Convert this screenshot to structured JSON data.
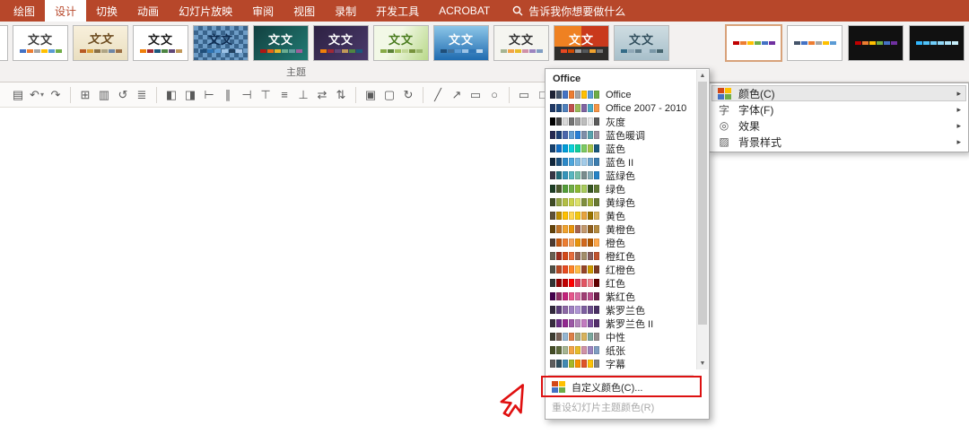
{
  "tabbar": {
    "bg": "#B7472A",
    "tabs": [
      {
        "label": "绘图",
        "selected": false
      },
      {
        "label": "设计",
        "selected": true
      },
      {
        "label": "切换",
        "selected": false
      },
      {
        "label": "动画",
        "selected": false
      },
      {
        "label": "幻灯片放映",
        "selected": false
      },
      {
        "label": "审阅",
        "selected": false
      },
      {
        "label": "视图",
        "selected": false
      },
      {
        "label": "录制",
        "selected": false
      },
      {
        "label": "开发工具",
        "selected": false
      },
      {
        "label": "ACROBAT",
        "selected": false
      }
    ],
    "tellme_label": "告诉我你想要做什么"
  },
  "themes": {
    "group_label": "主题",
    "items": [
      {
        "partial": true,
        "label": "",
        "bg": "#ffffff"
      },
      {
        "label": "文文",
        "bg": "#ffffff",
        "fg": "#404040",
        "strip": [
          "#4472C4",
          "#ED7D31",
          "#A5A5A5",
          "#FFC000",
          "#5B9BD5",
          "#70AD47"
        ]
      },
      {
        "label": "文文",
        "bg": "linear-gradient(180deg,#f8f0dc,#eadfc0)",
        "fg": "#6b4a1e",
        "script": true,
        "strip": [
          "#B85A23",
          "#D99E36",
          "#8A6F45",
          "#B0A584",
          "#6F87A6",
          "#9C6F44"
        ]
      },
      {
        "label": "文文",
        "bg": "#ffffff",
        "fg": "#1a1a1a",
        "serif": true,
        "strip": [
          "#F07F09",
          "#9F2936",
          "#1B587C",
          "#4E8542",
          "#604878",
          "#C19859"
        ]
      },
      {
        "label": "文文",
        "bg": "conic-gradient(#39648c 25%, #6d9cc6 0 50%, #39648c 0 75%, #6d9cc6 0) 0 0 / 10px 10px",
        "fg": "#0f2d52",
        "strip": [
          "#1F4E79",
          "#2E75B6",
          "#5B9BD5",
          "#9DC3E6",
          "#21405F",
          "#A7C6E8"
        ]
      },
      {
        "label": "文文",
        "bg": "linear-gradient(135deg,#123f3f,#217c74)",
        "fg": "#ffffff",
        "strip": [
          "#B01513",
          "#EA6312",
          "#E6B729",
          "#6AAC90",
          "#5F9C9D",
          "#9E5E9B"
        ]
      },
      {
        "label": "文文",
        "bg": "linear-gradient(135deg,#2d2142,#4a3a6b)",
        "fg": "#ffffff",
        "strip": [
          "#F07F09",
          "#9F2936",
          "#604878",
          "#C19859",
          "#4E8542",
          "#1B587C"
        ]
      },
      {
        "label": "文文",
        "bg": "linear-gradient(120deg,#f2f8e6 40%,#b9d98a)",
        "fg": "#4a7c1f",
        "strip": [
          "#87AB47",
          "#5B8236",
          "#A2C05E",
          "#C2D796",
          "#77933C",
          "#9CB86E"
        ]
      },
      {
        "label": "文文",
        "bg": "linear-gradient(180deg,#8cc6e8,#1f6bb0)",
        "fg": "#ffffff",
        "strip": [
          "#1F4E79",
          "#41719C",
          "#5B9BD5",
          "#9DC3E6",
          "#2E75B6",
          "#BDD7EE"
        ]
      },
      {
        "label": "文文",
        "bg": "#f5f5f0",
        "fg": "#333333",
        "strip": [
          "#A5B592",
          "#F3A447",
          "#E7BC29",
          "#D092A7",
          "#9C85C0",
          "#809EC2"
        ]
      },
      {
        "label": "文文",
        "bg": "linear-gradient(180deg, rgba(0,0,0,0) 60%, #2f2d2b 60%), linear-gradient(90deg,#ef8122 50%,#c9391c 50%)",
        "fg": "#ffffff",
        "strip": [
          "#E64823",
          "#D04A02",
          "#9C9C9C",
          "#54585B",
          "#F0A22E",
          "#777777"
        ]
      },
      {
        "label": "文文",
        "bg": "linear-gradient(180deg,#cfdde2,#a7bfca)",
        "fg": "#33505e",
        "strip": [
          "#336B87",
          "#90A8B7",
          "#5F7C8A",
          "#B4C9D4",
          "#7A98A8",
          "#46656F"
        ]
      }
    ]
  },
  "variants": {
    "items": [
      {
        "bg": "#ffffff",
        "selected": true,
        "strip": [
          "#C00000",
          "#ED7D31",
          "#FFC000",
          "#70AD47",
          "#4472C4",
          "#7030A0"
        ]
      },
      {
        "bg": "#ffffff",
        "selected": false,
        "strip": [
          "#44546A",
          "#4472C4",
          "#ED7D31",
          "#A5A5A5",
          "#FFC000",
          "#5B9BD5"
        ]
      },
      {
        "bg": "#111111",
        "selected": false,
        "strip": [
          "#C00000",
          "#ED7D31",
          "#FFC000",
          "#70AD47",
          "#4472C4",
          "#7030A0"
        ]
      },
      {
        "bg": "#111111",
        "selected": false,
        "strip": [
          "#31B6FD",
          "#51C3F9",
          "#70CDF9",
          "#8FD8F8",
          "#AEE3F8",
          "#C5ECF9"
        ]
      }
    ]
  },
  "variants_menu": {
    "items": [
      {
        "key": "colors",
        "label": "颜色(C)",
        "highlighted": true,
        "icon_glyph": ""
      },
      {
        "key": "fonts",
        "label": "字体(F)",
        "highlighted": false,
        "icon_glyph": "字"
      },
      {
        "key": "effects",
        "label": "效果",
        "highlighted": false,
        "icon_glyph": "◎"
      },
      {
        "key": "background-styles",
        "label": "背景样式",
        "highlighted": false,
        "icon_glyph": "▨"
      }
    ],
    "chevron_glyph": "▸",
    "palette_icon_colors": [
      "#D34817",
      "#FFC000",
      "#4472C4",
      "#70AD47"
    ]
  },
  "colors_menu": {
    "header": "Office",
    "schemes": [
      {
        "name": "Office",
        "colors": [
          "#1F2437",
          "#44546A",
          "#4472C4",
          "#ED7D31",
          "#A5A5A5",
          "#FFC000",
          "#5B9BD5",
          "#70AD47"
        ]
      },
      {
        "name": "Office 2007 - 2010",
        "colors": [
          "#1F3864",
          "#1F497D",
          "#4F81BD",
          "#C0504D",
          "#9BBB59",
          "#8064A2",
          "#4BACC6",
          "#F79646"
        ]
      },
      {
        "name": "灰度",
        "colors": [
          "#000000",
          "#3F3F3F",
          "#D9D9D9",
          "#757575",
          "#9C9C9C",
          "#BDBDBD",
          "#E8E8E8",
          "#5B5B5B"
        ]
      },
      {
        "name": "蓝色暖调",
        "colors": [
          "#242852",
          "#1B3E75",
          "#4A66AC",
          "#629DD1",
          "#297FD5",
          "#7F8FA9",
          "#5AA2AE",
          "#9D90A0"
        ]
      },
      {
        "name": "蓝色",
        "colors": [
          "#17406D",
          "#0F6FC6",
          "#009DD9",
          "#0BD0D9",
          "#10CF9B",
          "#7CCA62",
          "#A5C249",
          "#1B587C"
        ]
      },
      {
        "name": "蓝色 II",
        "colors": [
          "#10263C",
          "#1B4E79",
          "#2C89C8",
          "#4EA6DC",
          "#7BB8E0",
          "#A3CCE9",
          "#6BA3CC",
          "#3C7DAF"
        ]
      },
      {
        "name": "蓝绿色",
        "colors": [
          "#373545",
          "#226A77",
          "#3494BA",
          "#58B6C0",
          "#75BDA7",
          "#7A8C8E",
          "#84ACB6",
          "#2683C6"
        ]
      },
      {
        "name": "绿色",
        "colors": [
          "#1D3E25",
          "#49582D",
          "#549E39",
          "#70AD47",
          "#8AB833",
          "#A9CC5D",
          "#375623",
          "#607934"
        ]
      },
      {
        "name": "黄绿色",
        "colors": [
          "#3F4C24",
          "#93A345",
          "#B2BE45",
          "#CBD24C",
          "#DDE26A",
          "#7F8F3E",
          "#A3B138",
          "#6A7A33"
        ]
      },
      {
        "name": "黄色",
        "colors": [
          "#5F5136",
          "#BF8F00",
          "#FFC000",
          "#FFD54F",
          "#F2C811",
          "#E8A33D",
          "#997300",
          "#D8B25C"
        ]
      },
      {
        "name": "黄橙色",
        "colors": [
          "#63430A",
          "#C17529",
          "#F0A22E",
          "#E8940C",
          "#A5644E",
          "#C3986D",
          "#8F5F1F",
          "#B58B40"
        ]
      },
      {
        "name": "橙色",
        "colors": [
          "#4E3B30",
          "#C55A11",
          "#ED7D31",
          "#F4A460",
          "#E8940C",
          "#D2691E",
          "#B35900",
          "#FFA94D"
        ]
      },
      {
        "name": "橙红色",
        "colors": [
          "#695F52",
          "#9B2D1F",
          "#D34817",
          "#E66C3C",
          "#956251",
          "#A28E6A",
          "#855D5D",
          "#C0532F"
        ]
      },
      {
        "name": "红橙色",
        "colors": [
          "#505046",
          "#B64926",
          "#E84C22",
          "#FF8427",
          "#FFBD47",
          "#96462A",
          "#CC9900",
          "#7A3A22"
        ]
      },
      {
        "name": "红色",
        "colors": [
          "#323232",
          "#900000",
          "#C00000",
          "#FF0000",
          "#D93954",
          "#E25563",
          "#F1828D",
          "#600000"
        ]
      },
      {
        "name": "紫红色",
        "colors": [
          "#45004D",
          "#8F2C63",
          "#C3217A",
          "#E6568B",
          "#D86AA0",
          "#A03E75",
          "#B84A8A",
          "#6E1F4C"
        ]
      },
      {
        "name": "紫罗兰色",
        "colors": [
          "#32293D",
          "#5A3E78",
          "#8C68A6",
          "#9E7FC1",
          "#AF95D4",
          "#7D5FA0",
          "#6B4E8C",
          "#493064"
        ]
      },
      {
        "name": "紫罗兰色 II",
        "colors": [
          "#372C3F",
          "#692C85",
          "#92278F",
          "#9B57A5",
          "#B384BB",
          "#C27BC0",
          "#7D4F9E",
          "#542F6B"
        ]
      },
      {
        "name": "中性",
        "colors": [
          "#3E3D33",
          "#775F55",
          "#94B6D2",
          "#DD8047",
          "#A5AB81",
          "#D8B25C",
          "#7BA79D",
          "#968C8C"
        ]
      },
      {
        "name": "纸张",
        "colors": [
          "#444D26",
          "#5D6A3C",
          "#A5B592",
          "#F3A447",
          "#E7BC29",
          "#D092A7",
          "#9C85C0",
          "#809EC2"
        ]
      },
      {
        "name": "字幕",
        "colors": [
          "#5E5E5E",
          "#304F5E",
          "#418AB3",
          "#A6B727",
          "#F69200",
          "#DF5327",
          "#FEC306",
          "#838383"
        ]
      }
    ],
    "custom_label": "自定义颜色(C)...",
    "reset_label": "重设幻灯片主题颜色(R)",
    "scroll_up_glyph": "▲",
    "scroll_down_glyph": "▼"
  },
  "toolbar": {
    "icons": [
      {
        "name": "save-icon",
        "glyph": "▤"
      },
      {
        "name": "undo-icon",
        "glyph": "↶",
        "caret": true
      },
      {
        "name": "redo-icon",
        "glyph": "↷"
      },
      {
        "sep": true
      },
      {
        "name": "new-slide-icon",
        "glyph": "⊞"
      },
      {
        "name": "slide-layout-icon",
        "glyph": "▥"
      },
      {
        "name": "reset-slide-icon",
        "glyph": "↺"
      },
      {
        "name": "section-icon",
        "glyph": "≣"
      },
      {
        "sep": true
      },
      {
        "name": "bring-forward-icon",
        "glyph": "◧"
      },
      {
        "name": "send-backward-icon",
        "glyph": "◨"
      },
      {
        "name": "align-left-icon",
        "glyph": "⊢"
      },
      {
        "name": "align-center-icon",
        "glyph": "∥"
      },
      {
        "name": "align-right-icon",
        "glyph": "⊣"
      },
      {
        "name": "align-top-icon",
        "glyph": "⊤"
      },
      {
        "name": "align-middle-icon",
        "glyph": "≡"
      },
      {
        "name": "align-bottom-icon",
        "glyph": "⊥"
      },
      {
        "name": "distribute-horizontal-icon",
        "glyph": "⇄"
      },
      {
        "name": "distribute-vertical-icon",
        "glyph": "⇅"
      },
      {
        "sep": true
      },
      {
        "name": "group-icon",
        "glyph": "▣"
      },
      {
        "name": "ungroup-icon",
        "glyph": "▢"
      },
      {
        "name": "rotate-icon",
        "glyph": "↻"
      },
      {
        "sep": true
      },
      {
        "name": "shape-line-icon",
        "glyph": "╱"
      },
      {
        "name": "shape-arrow-icon",
        "glyph": "↗"
      },
      {
        "name": "shape-rectangle-icon",
        "glyph": "▭"
      },
      {
        "name": "shape-oval-icon",
        "glyph": "○"
      },
      {
        "sep": true
      },
      {
        "name": "rectangle-icon",
        "glyph": "▭"
      },
      {
        "name": "square-icon",
        "glyph": "□"
      },
      {
        "name": "circle-icon",
        "glyph": "○"
      }
    ]
  },
  "annotation": {
    "box_color": "#dd1111"
  }
}
